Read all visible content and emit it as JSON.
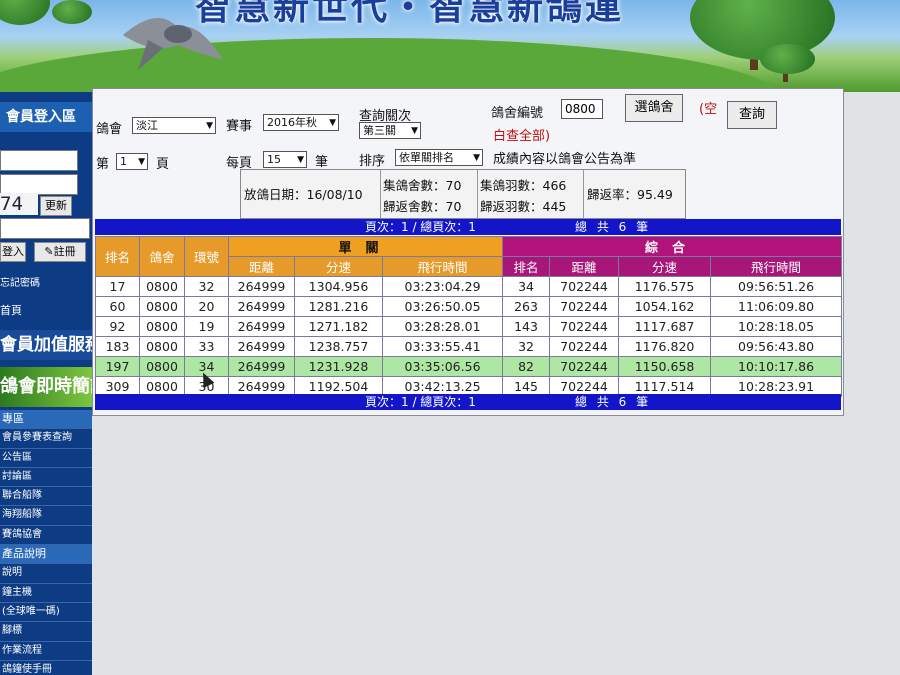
{
  "banner": {
    "title": "智慧新世代・智慧新鴿運"
  },
  "sidebar": {
    "login_title": "會員登入區",
    "captcha": "74",
    "refresh_btn": "更新",
    "login_btn": "登入",
    "register_btn": "註冊",
    "forgot_link": "忘記密碼",
    "home_link": "首頁",
    "vip_banner": "會員加值服務",
    "news_banner": "鴿會即時簡訊",
    "menu": [
      {
        "label": "專區",
        "header": true
      },
      {
        "label": "會員參賽表查詢",
        "header": false
      },
      {
        "label": "公告區",
        "header": false
      },
      {
        "label": "討論區",
        "header": false
      },
      {
        "label": "聯合船隊",
        "header": false
      },
      {
        "label": "海翔船隊",
        "header": false
      },
      {
        "label": "賽鴿協會",
        "header": false
      },
      {
        "label": "產品說明",
        "header": true
      },
      {
        "label": "說明",
        "header": false
      },
      {
        "label": "鐘主機",
        "header": false
      },
      {
        "label": "(全球唯一碼)",
        "header": false
      },
      {
        "label": "腳標",
        "header": false
      },
      {
        "label": "作業流程",
        "header": false
      },
      {
        "label": "鴿鐘使手冊",
        "header": false
      }
    ]
  },
  "filters": {
    "club_label": "鴿會",
    "club_value": "淡江",
    "race_label": "賽事",
    "race_value": "2016年秋",
    "query_label": "查詢關次",
    "query_value": "第三關",
    "loft_label": "鴿舍編號",
    "loft_value": "0800",
    "choose_loft_btn": "選鴿舍",
    "note_paren": "(空",
    "note_rest": "白查全部)",
    "query_btn": "查詢",
    "page_label": "第",
    "page_value": "1",
    "page_unit": "頁",
    "per_page_label": "每頁",
    "per_page_value": "15",
    "per_page_unit": "筆",
    "sort_label": "排序",
    "sort_value": "依單關排名",
    "disclaimer": "成績內容以鴿會公告為準"
  },
  "info": {
    "release_date": "放鴿日期：16/08/10",
    "loft_count": "集鴿舍數：70",
    "bird_count": "集鴿羽數：466",
    "return_loft": "歸返舍數：70",
    "return_bird": "歸返羽數：445",
    "return_rate": "歸返率：95.49"
  },
  "pager": {
    "page_text": "頁次：1 / 總頁次：1",
    "total_text": "總 共 6 筆"
  },
  "table": {
    "group_single": "單關",
    "group_combined": "綜合",
    "col_rank": "排名",
    "col_loft": "鴿舍",
    "col_ring": "環號",
    "col_distance": "距離",
    "col_speed": "分速",
    "col_time": "飛行時間",
    "rows": [
      {
        "rank": "17",
        "loft": "0800",
        "ring": "32",
        "dist": "264999",
        "speed": "1304.956",
        "time": "03:23:04.29",
        "c_rank": "34",
        "c_dist": "702244",
        "c_speed": "1176.575",
        "c_time": "09:56:51.26"
      },
      {
        "rank": "60",
        "loft": "0800",
        "ring": "20",
        "dist": "264999",
        "speed": "1281.216",
        "time": "03:26:50.05",
        "c_rank": "263",
        "c_dist": "702244",
        "c_speed": "1054.162",
        "c_time": "11:06:09.80"
      },
      {
        "rank": "92",
        "loft": "0800",
        "ring": "19",
        "dist": "264999",
        "speed": "1271.182",
        "time": "03:28:28.01",
        "c_rank": "143",
        "c_dist": "702244",
        "c_speed": "1117.687",
        "c_time": "10:28:18.05"
      },
      {
        "rank": "183",
        "loft": "0800",
        "ring": "33",
        "dist": "264999",
        "speed": "1238.757",
        "time": "03:33:55.41",
        "c_rank": "32",
        "c_dist": "702244",
        "c_speed": "1176.820",
        "c_time": "09:56:43.80"
      },
      {
        "rank": "197",
        "loft": "0800",
        "ring": "34",
        "dist": "264999",
        "speed": "1231.928",
        "time": "03:35:06.56",
        "c_rank": "82",
        "c_dist": "702244",
        "c_speed": "1150.658",
        "c_time": "10:10:17.86"
      },
      {
        "rank": "309",
        "loft": "0800",
        "ring": "30",
        "dist": "264999",
        "speed": "1192.504",
        "time": "03:42:13.25",
        "c_rank": "145",
        "c_dist": "702244",
        "c_speed": "1117.514",
        "c_time": "10:28:23.91"
      }
    ]
  },
  "colors": {
    "single_header": "#e59a2a",
    "combined_header": "#a8167a",
    "pager_bar": "#1216c8",
    "highlight_row": "#aee6a4"
  }
}
